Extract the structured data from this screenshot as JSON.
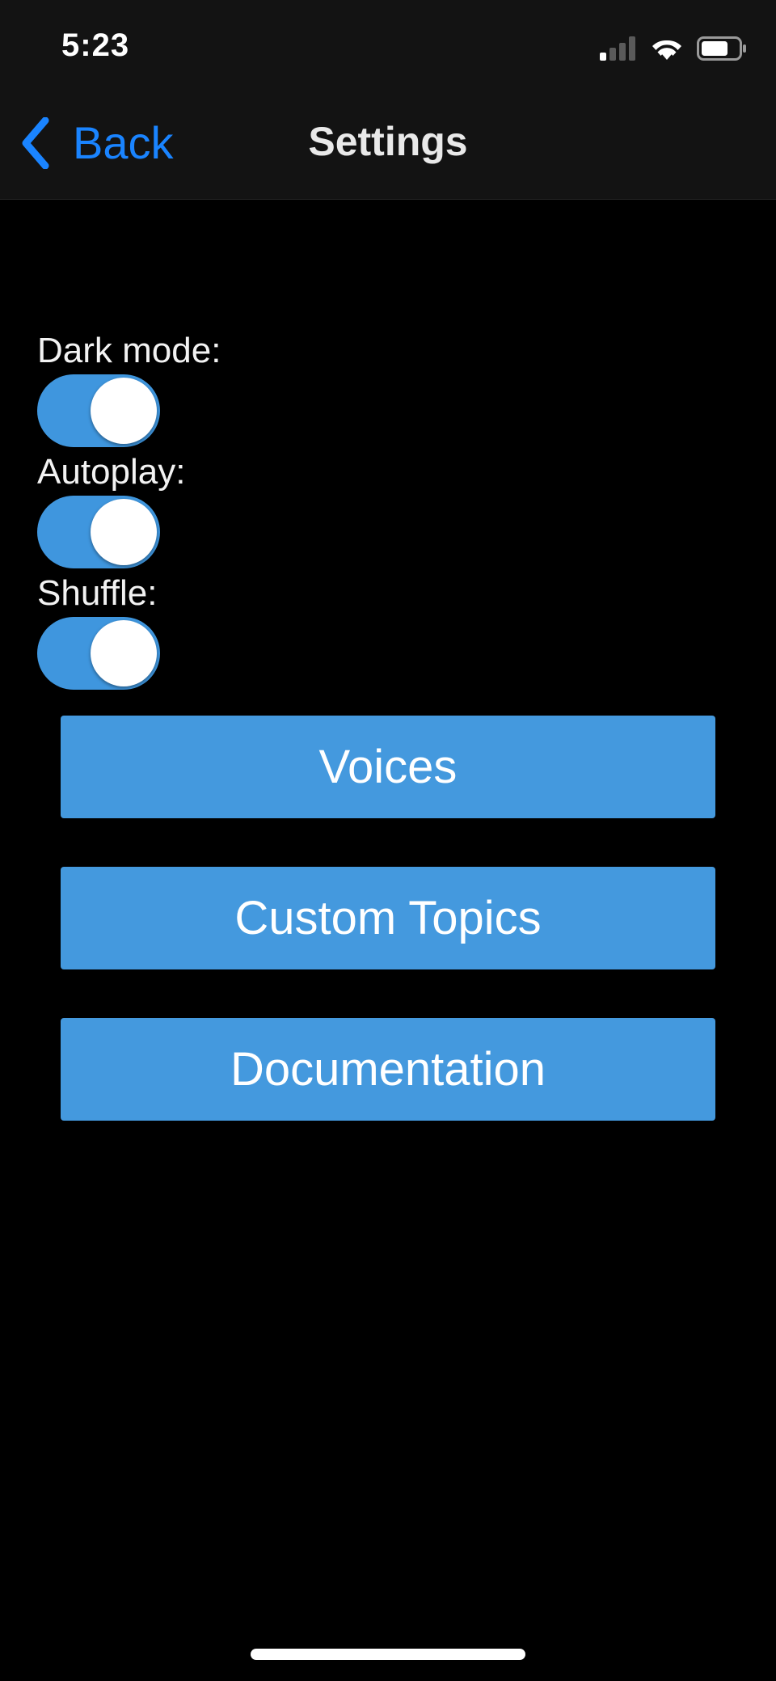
{
  "status_bar": {
    "time": "5:23"
  },
  "nav": {
    "back_label": "Back",
    "title": "Settings"
  },
  "settings": [
    {
      "label": "Dark mode:",
      "enabled": true
    },
    {
      "label": "Autoplay:",
      "enabled": true
    },
    {
      "label": "Shuffle:",
      "enabled": true
    }
  ],
  "buttons": {
    "voices": "Voices",
    "custom_topics": "Custom Topics",
    "documentation": "Documentation"
  },
  "colors": {
    "accent": "#1a84ff",
    "toggle_on": "#3f96de",
    "button_bg": "#4499de",
    "background": "#000000",
    "top_bar": "#131313"
  },
  "icons": {
    "signal": "cellular-signal-icon",
    "wifi": "wifi-icon",
    "battery": "battery-icon",
    "back": "chevron-left-icon"
  }
}
